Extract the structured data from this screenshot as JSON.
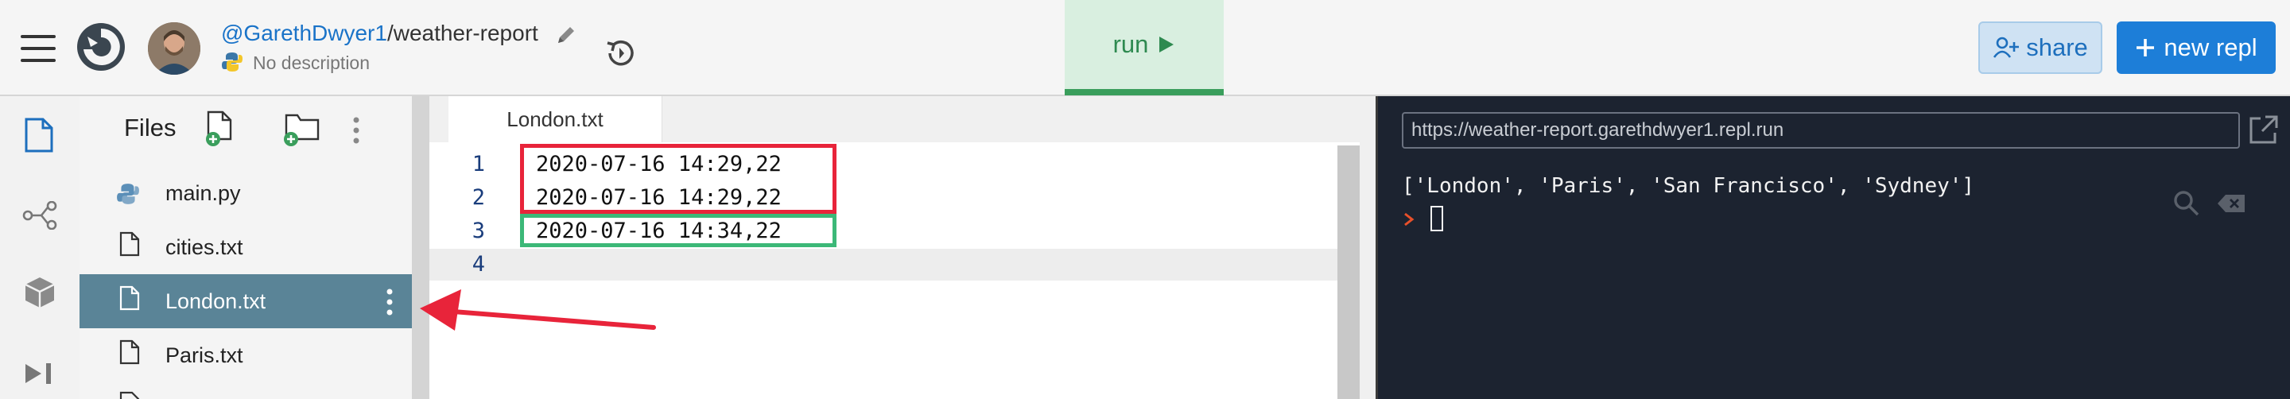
{
  "header": {
    "repo_owner": "@GarethDwyer1",
    "repo_separator": "/",
    "repo_name": "weather-report",
    "description": "No description",
    "run_label": "run",
    "share_label": "share",
    "new_repl_label": "new repl"
  },
  "files_panel": {
    "title": "Files",
    "items": [
      {
        "label": "main.py",
        "type": "python"
      },
      {
        "label": "cities.txt",
        "type": "file"
      },
      {
        "label": "London.txt",
        "type": "file",
        "selected": true
      },
      {
        "label": "Paris.txt",
        "type": "file"
      }
    ]
  },
  "editor": {
    "tab_label": "London.txt",
    "lines": [
      {
        "num": "1",
        "text": "2020-07-16 14:29,22"
      },
      {
        "num": "2",
        "text": "2020-07-16 14:29,22"
      },
      {
        "num": "3",
        "text": "2020-07-16 14:34,22"
      },
      {
        "num": "4",
        "text": ""
      }
    ]
  },
  "console": {
    "url": "https://weather-report.garethdwyer1.repl.run",
    "output": "['London', 'Paris', 'San Francisco', 'Sydney']"
  },
  "colors": {
    "accent_blue": "#1d7ed8",
    "run_green": "#3a9e5c",
    "annotation_red": "#e8243a",
    "annotation_green": "#3cb878",
    "selected_row": "#5a8497",
    "console_bg": "#1c2330"
  }
}
